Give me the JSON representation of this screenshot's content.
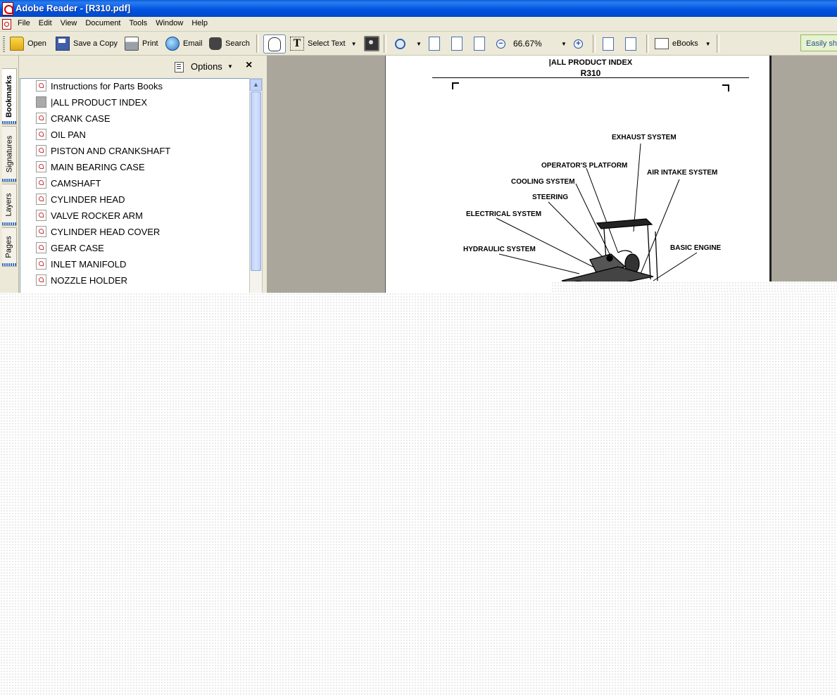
{
  "window": {
    "title": "Adobe Reader - [R310.pdf]"
  },
  "menu": [
    "File",
    "Edit",
    "View",
    "Document",
    "Tools",
    "Window",
    "Help"
  ],
  "toolbar": {
    "open": "Open",
    "save_copy": "Save a Copy",
    "print": "Print",
    "email": "Email",
    "search": "Search",
    "select_text": "Select Text",
    "zoom_value": "66.67%",
    "ebooks": "eBooks",
    "easily_share": "Easily share"
  },
  "nav_tabs": [
    "Bookmarks",
    "Signatures",
    "Layers",
    "Pages"
  ],
  "bookmarks_panel": {
    "options_label": "Options",
    "close_glyph": "×",
    "items": [
      {
        "label": "Instructions for Parts Books",
        "icon": "pdf-bookmark-icon"
      },
      {
        "label": "|ALL PRODUCT INDEX",
        "icon": "page-bookmark-icon"
      },
      {
        "label": "CRANK CASE",
        "icon": "pdf-bookmark-icon"
      },
      {
        "label": "OIL PAN",
        "icon": "pdf-bookmark-icon"
      },
      {
        "label": "PISTON AND CRANKSHAFT",
        "icon": "pdf-bookmark-icon"
      },
      {
        "label": "MAIN BEARING CASE",
        "icon": "pdf-bookmark-icon"
      },
      {
        "label": "CAMSHAFT",
        "icon": "pdf-bookmark-icon"
      },
      {
        "label": "CYLINDER HEAD",
        "icon": "pdf-bookmark-icon"
      },
      {
        "label": "VALVE ROCKER ARM",
        "icon": "pdf-bookmark-icon"
      },
      {
        "label": "CYLINDER HEAD COVER",
        "icon": "pdf-bookmark-icon"
      },
      {
        "label": "GEAR CASE",
        "icon": "pdf-bookmark-icon"
      },
      {
        "label": "INLET MANIFOLD",
        "icon": "pdf-bookmark-icon"
      },
      {
        "label": "NOZZLE HOLDER",
        "icon": "pdf-bookmark-icon"
      }
    ]
  },
  "document": {
    "header_line1": "|ALL PRODUCT INDEX",
    "header_line2": "R310",
    "callouts": [
      "EXHAUST SYSTEM",
      "OPERATOR'S PLATFORM",
      "AIR INTAKE SYSTEM",
      "COOLING SYSTEM",
      "STEERING",
      "ELECTRICAL SYSTEM",
      "BASIC ENGINE",
      "HYDRAULIC SYSTEM"
    ]
  }
}
